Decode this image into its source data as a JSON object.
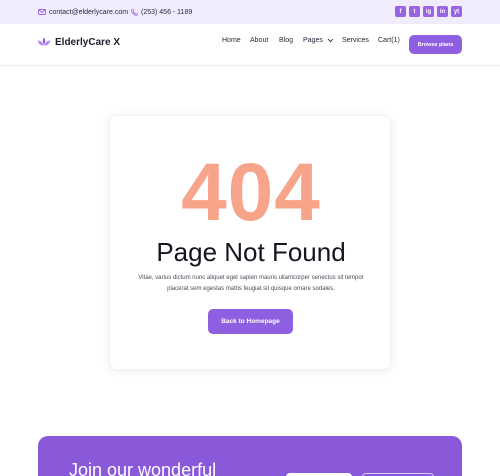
{
  "topbar": {
    "email": "contact@elderlycare.com",
    "phone": "(253) 456 - 1189",
    "social": [
      "f",
      "t",
      "ig",
      "in",
      "yt"
    ]
  },
  "header": {
    "logo_text": "ElderlyCare X",
    "nav": {
      "home": "Home",
      "about": "About",
      "blog": "Blog",
      "pages": "Pages",
      "services": "Services",
      "cart": "Cart(1)"
    },
    "browse_label": "Browse plans"
  },
  "error": {
    "code": "404",
    "title": "Page Not Found",
    "description": "Vitae, varius dictum nunc aliquet eget sapien mauris ullamcorper senectus sit tempor placerat sem egestas mattis feugiat sit quisque ornare sodales.",
    "back_label": "Back to Homepage"
  },
  "banner": {
    "title": "Join our wonderful"
  },
  "colors": {
    "accent": "#8e5fe0",
    "code404": "#f8a48a",
    "topbar_bg": "#f1ecfd"
  }
}
